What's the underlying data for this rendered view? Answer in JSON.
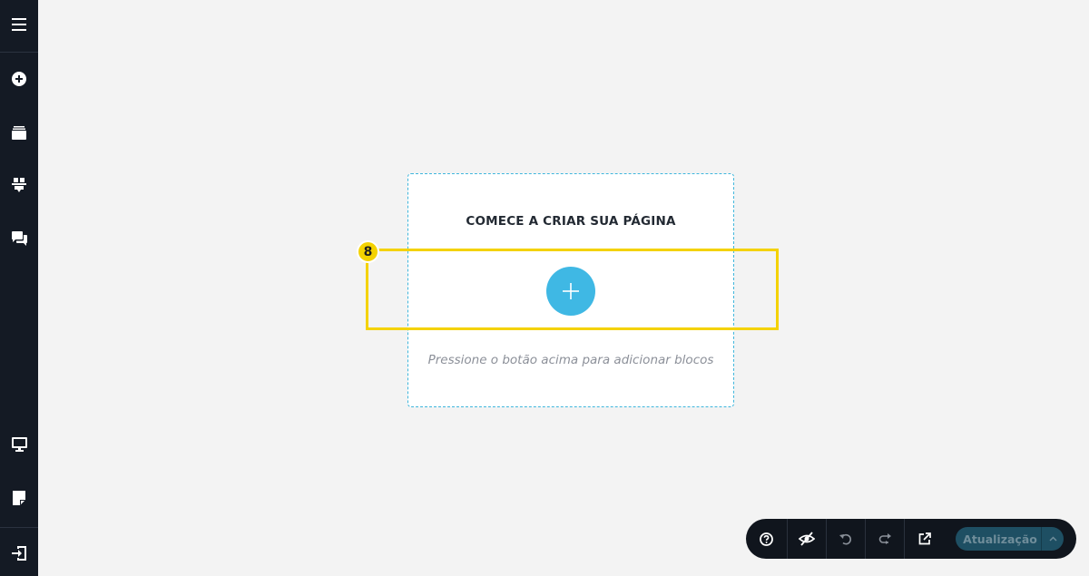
{
  "sidebar": {
    "items": [
      {
        "icon": "hamburger-menu-icon"
      },
      {
        "icon": "add-circle-icon"
      },
      {
        "icon": "layers-icon"
      },
      {
        "icon": "blocks-icon"
      },
      {
        "icon": "comments-icon"
      },
      {
        "icon": "desktop-preview-icon"
      },
      {
        "icon": "page-settings-icon"
      },
      {
        "icon": "exit-icon"
      }
    ]
  },
  "canvas": {
    "title": "COMECE A CRIAR SUA PÁGINA",
    "add_button_symbol": "+",
    "hint": "Pressione o botão acima para adicionar blocos"
  },
  "highlight": {
    "badge": "8",
    "color": "#f4d200"
  },
  "toolbar": {
    "buttons": [
      {
        "icon": "help-icon"
      },
      {
        "icon": "eye-off-icon"
      },
      {
        "icon": "undo-icon"
      },
      {
        "icon": "redo-icon"
      },
      {
        "icon": "external-link-icon"
      }
    ],
    "update_label": "Atualização"
  },
  "colors": {
    "sidebar_bg": "#141a24",
    "accent": "#3fb8e4",
    "toolbar_bg": "#10151d",
    "update_bg": "#1e4f63"
  }
}
